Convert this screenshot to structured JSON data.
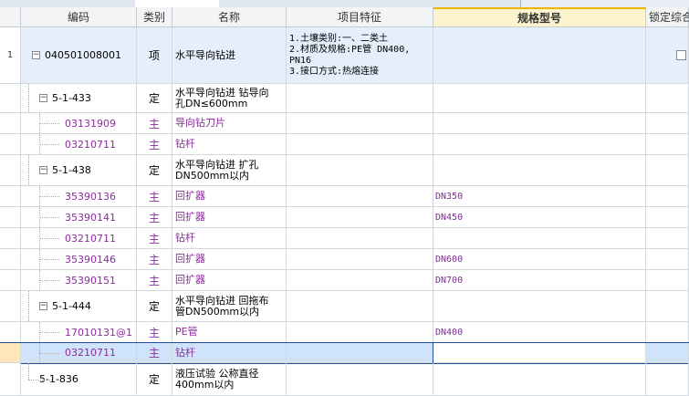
{
  "columns": {
    "code": "编码",
    "category": "类别",
    "name": "名称",
    "features": "项目特征",
    "spec": "规格型号",
    "lock": "锁定综合"
  },
  "rows": [
    {
      "idx": "1",
      "code": "040501008001",
      "cat": "项",
      "name": "水平导向钻进",
      "features": "1.土壤类别:一、二类土\n2.材质及规格:PE管 DN400,\nPN16\n3.接口方式:热熔连接",
      "spec": ""
    },
    {
      "idx": "",
      "code": "5-1-433",
      "cat": "定",
      "name": "水平导向钻进 钻导向\n孔DN≤600mm",
      "features": "",
      "spec": ""
    },
    {
      "idx": "",
      "code": "03131909",
      "cat": "主",
      "name": "导向钻刀片",
      "features": "",
      "spec": ""
    },
    {
      "idx": "",
      "code": "03210711",
      "cat": "主",
      "name": "钻杆",
      "features": "",
      "spec": ""
    },
    {
      "idx": "",
      "code": "5-1-438",
      "cat": "定",
      "name": "水平导向钻进 扩孔\nDN500mm以内",
      "features": "",
      "spec": ""
    },
    {
      "idx": "",
      "code": "35390136",
      "cat": "主",
      "name": "回扩器",
      "features": "",
      "spec": "DN350"
    },
    {
      "idx": "",
      "code": "35390141",
      "cat": "主",
      "name": "回扩器",
      "features": "",
      "spec": "DN450"
    },
    {
      "idx": "",
      "code": "03210711",
      "cat": "主",
      "name": "钻杆",
      "features": "",
      "spec": ""
    },
    {
      "idx": "",
      "code": "35390146",
      "cat": "主",
      "name": "回扩器",
      "features": "",
      "spec": "DN600"
    },
    {
      "idx": "",
      "code": "35390151",
      "cat": "主",
      "name": "回扩器",
      "features": "",
      "spec": "DN700"
    },
    {
      "idx": "",
      "code": "5-1-444",
      "cat": "定",
      "name": "水平导向钻进 回拖布\n管DN500mm以内",
      "features": "",
      "spec": ""
    },
    {
      "idx": "",
      "code": "17010131@1",
      "cat": "主",
      "name": "PE管",
      "features": "",
      "spec": "DN400"
    },
    {
      "idx": "",
      "code": "03210711",
      "cat": "主",
      "name": "钻杆",
      "features": "",
      "spec": ""
    },
    {
      "idx": "",
      "code": "5-1-836",
      "cat": "定",
      "name": "液压试验 公称直径\n400mm以内",
      "features": "",
      "spec": ""
    }
  ],
  "expander_symbol": "−",
  "colors": {
    "material_text": "#8b2c9c",
    "selection": "#cfe3fb",
    "spec_header": "#fcf3cf"
  }
}
